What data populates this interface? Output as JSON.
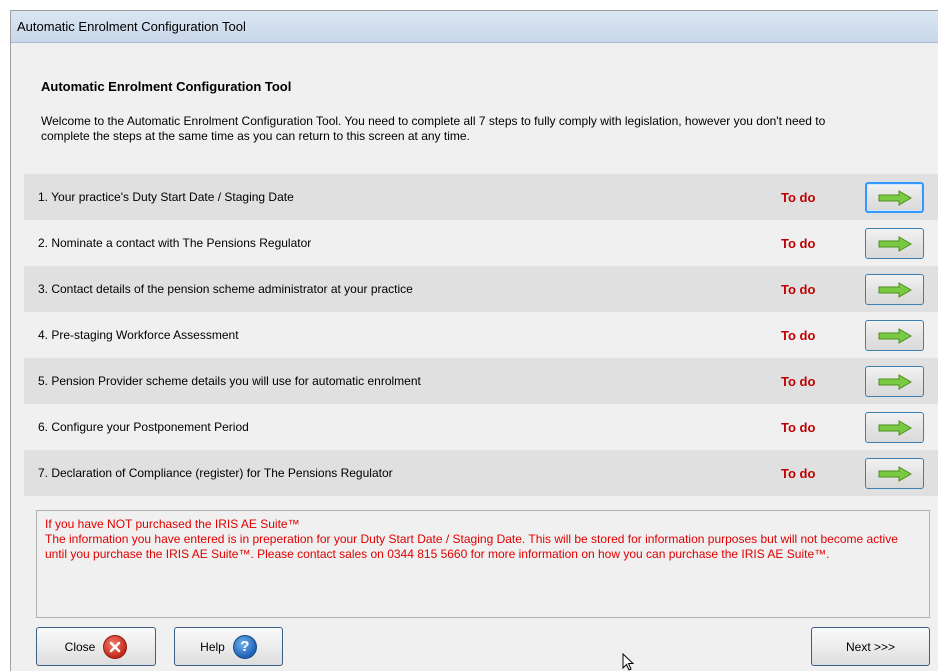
{
  "window": {
    "title": "Automatic Enrolment Configuration Tool"
  },
  "main": {
    "heading": "Automatic Enrolment Configuration Tool",
    "intro": "Welcome to the Automatic Enrolment Configuration Tool.  You need to complete all 7 steps to fully comply with legislation, however you don't need to complete the steps at the same time as you can return to this screen at any time."
  },
  "steps": [
    {
      "label": "1.  Your practice's Duty Start Date / Staging Date",
      "status": "To do"
    },
    {
      "label": "2.  Nominate a contact with The Pensions Regulator",
      "status": "To do"
    },
    {
      "label": "3.  Contact details of the pension scheme administrator at your practice",
      "status": "To do"
    },
    {
      "label": "4.  Pre-staging Workforce Assessment",
      "status": "To do"
    },
    {
      "label": "5.  Pension Provider scheme details you will use for automatic enrolment",
      "status": "To do"
    },
    {
      "label": "6.  Configure your Postponement Period",
      "status": "To do"
    },
    {
      "label": "7.  Declaration of Compliance (register) for The Pensions Regulator",
      "status": "To do"
    }
  ],
  "notice": {
    "line1": "If you have NOT purchased the  IRIS AE Suite™",
    "body": "The information you have entered is in preperation for your Duty Start Date / Staging Date.  This will be stored for information purposes but will not become active until you purchase the IRIS AE Suite™.  Please contact sales on 0344 815 5660 for more information on how you can purchase the  IRIS AE Suite™."
  },
  "buttons": {
    "close": "Close",
    "help": "Help",
    "next": "Next >>>"
  },
  "icons": {
    "step_arrow": "green-right-arrow-icon",
    "close": "red-x-circle-icon",
    "help": "blue-question-circle-icon"
  },
  "colors": {
    "status_todo": "#c00000",
    "notice_text": "#e00000",
    "arrow": "#7ac943"
  }
}
